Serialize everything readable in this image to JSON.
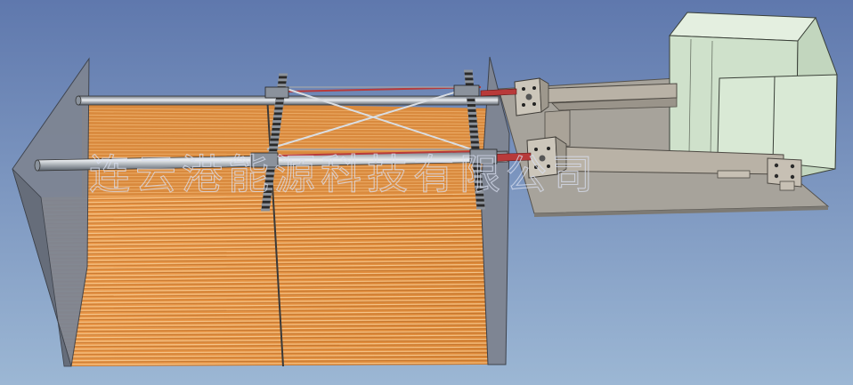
{
  "watermark": {
    "text": "连云港能源科技有限公司"
  },
  "colors": {
    "background_top": "#5f78ad",
    "background_bottom": "#9cb7d4",
    "plate_orange": "#e2903f",
    "plate_edge": "#f4c489",
    "panel_gray": "#7e8593",
    "base_plate": "#a7a39b",
    "cabinet": "#d6e6d2",
    "rod_red": "#b83a3a"
  },
  "scene": {
    "plate_count": 44
  }
}
